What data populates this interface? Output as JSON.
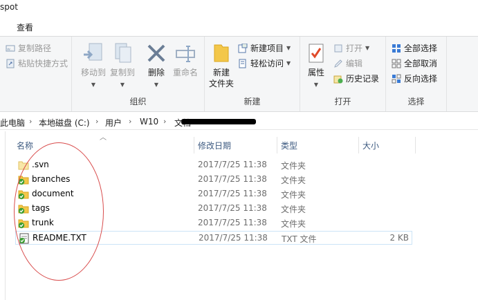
{
  "window": {
    "title_fragment": "spot"
  },
  "ribbon_tabs": {
    "view": "查看"
  },
  "ribbon": {
    "clipboard": {
      "copy_path": "复制路径",
      "paste_shortcut": "粘贴快捷方式"
    },
    "organize": {
      "label": "组织",
      "move_to": "移动到",
      "copy_to": "复制到",
      "delete": "删除",
      "rename": "重命名"
    },
    "new": {
      "label": "新建",
      "new_folder_line1": "新建",
      "new_folder_line2": "文件夹",
      "new_item": "新建项目",
      "easy_access": "轻松访问"
    },
    "open": {
      "label": "打开",
      "properties": "属性",
      "open": "打开",
      "edit": "编辑",
      "history": "历史记录"
    },
    "select": {
      "label": "选择",
      "select_all": "全部选择",
      "select_none": "全部取消",
      "invert": "反向选择"
    }
  },
  "address": {
    "crumbs": [
      "此电脑",
      "本地磁盘 (C:)",
      "用户",
      "W10",
      "文档"
    ]
  },
  "columns": {
    "name": "名称",
    "date": "修改日期",
    "type": "类型",
    "size": "大小"
  },
  "files": [
    {
      "name": ".svn",
      "date": "2017/7/25 11:38",
      "type": "文件夹",
      "size": "",
      "icon": "folder-icon",
      "svn": false
    },
    {
      "name": "branches",
      "date": "2017/7/25 11:38",
      "type": "文件夹",
      "size": "",
      "icon": "folder-svn-icon",
      "svn": true
    },
    {
      "name": "document",
      "date": "2017/7/25 11:38",
      "type": "文件夹",
      "size": "",
      "icon": "folder-svn-icon",
      "svn": true
    },
    {
      "name": "tags",
      "date": "2017/7/25 11:38",
      "type": "文件夹",
      "size": "",
      "icon": "folder-svn-icon",
      "svn": true
    },
    {
      "name": "trunk",
      "date": "2017/7/25 11:38",
      "type": "文件夹",
      "size": "",
      "icon": "folder-svn-icon",
      "svn": true
    },
    {
      "name": "README.TXT",
      "date": "2017/7/25 11:38",
      "type": "TXT 文件",
      "size": "2 KB",
      "icon": "text-file-icon",
      "svn": true
    }
  ]
}
